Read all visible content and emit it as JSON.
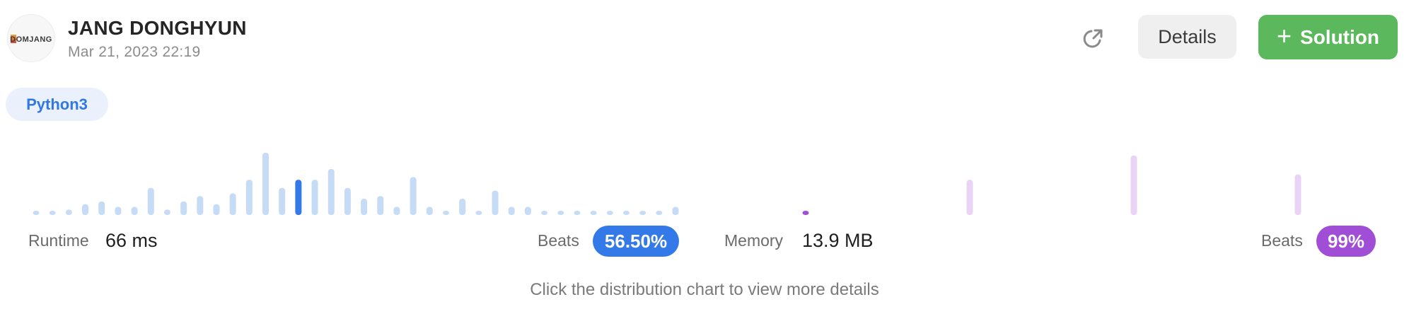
{
  "user": {
    "name": "JANG DONGHYUN",
    "date": "Mar 21, 2023 22:19",
    "avatar_text": "DOMJANG"
  },
  "actions": {
    "share_icon": "external-share-icon",
    "details_label": "Details",
    "solution_icon": "plus-icon",
    "solution_label": "Solution",
    "plus_glyph": "+"
  },
  "language": "Python3",
  "colors": {
    "runtime_bar": "#c6dcf6",
    "runtime_selected": "#3479e8",
    "memory_bar": "#ead4f5",
    "memory_selected": "#a04ed6",
    "solution_button": "#5cb85c",
    "details_button": "#efeff0"
  },
  "runtime": {
    "label": "Runtime",
    "value": "66 ms",
    "beats_label": "Beats",
    "beats_value": "56.50%"
  },
  "memory": {
    "label": "Memory",
    "value": "13.9 MB",
    "beats_label": "Beats",
    "beats_value": "99%"
  },
  "hint": "Click the distribution chart to view more details",
  "chart_data": [
    {
      "type": "bar",
      "name": "runtime-distribution",
      "values": [
        1,
        1,
        2,
        4,
        5,
        3,
        3,
        10,
        2,
        5,
        7,
        4,
        8,
        13,
        23,
        10,
        13,
        13,
        17,
        10,
        6,
        7,
        3,
        14,
        3,
        1,
        6,
        1,
        9,
        3,
        3,
        1,
        1,
        1,
        1,
        1,
        1,
        1,
        1,
        3
      ],
      "selected_index": 16,
      "ylim": [
        0,
        23
      ]
    },
    {
      "type": "bar",
      "name": "memory-distribution",
      "values": [
        1,
        0,
        0,
        0,
        0,
        0,
        0,
        0,
        0,
        0,
        13,
        0,
        0,
        0,
        0,
        0,
        0,
        0,
        0,
        0,
        22,
        0,
        0,
        0,
        0,
        0,
        0,
        0,
        0,
        0,
        15
      ],
      "selected_index": 0,
      "ylim": [
        0,
        23
      ]
    }
  ]
}
